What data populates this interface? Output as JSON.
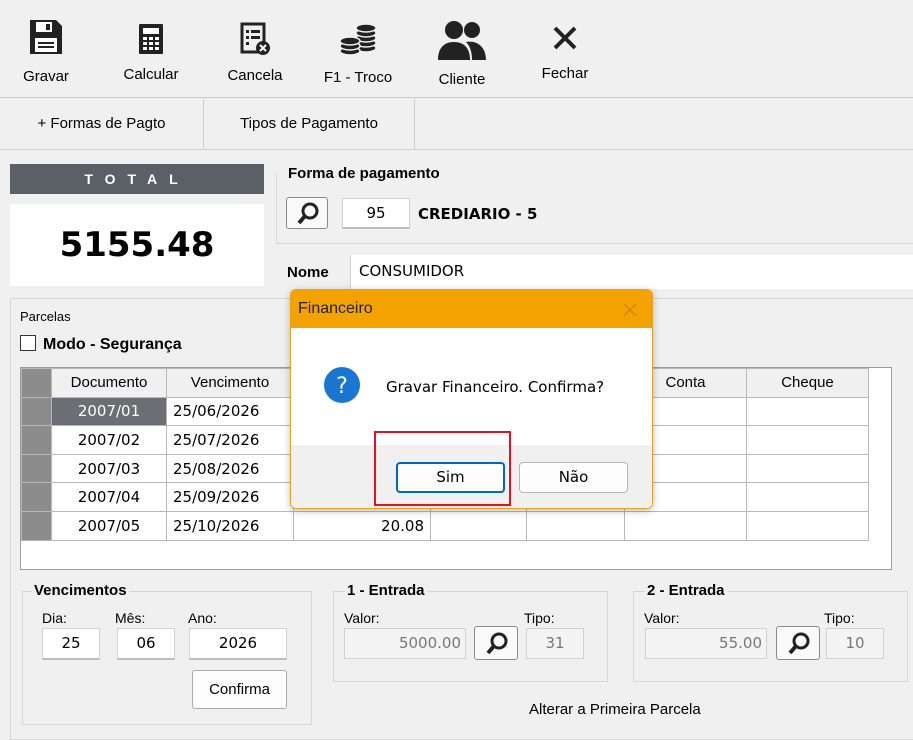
{
  "toolbar": {
    "gravar": "Gravar",
    "calcular": "Calcular",
    "cancela": "Cancela",
    "troco": "F1 - Troco",
    "cliente": "Cliente",
    "fechar": "Fechar"
  },
  "tabs": {
    "formas": "+ Formas de Pagto",
    "tipos": "Tipos de Pagamento"
  },
  "total": {
    "label": "TOTAL",
    "value": "5155.48"
  },
  "forma_pagamento": {
    "label": "Forma de pagamento",
    "code": "95",
    "name": "CREDIARIO - 5"
  },
  "nome": {
    "label": "Nome",
    "value": "CONSUMIDOR"
  },
  "parcelas": {
    "label": "Parcelas",
    "modo_seguranca": "Modo - Segurança"
  },
  "grid": {
    "columns": [
      "Documento",
      "Vencimento",
      "",
      "",
      "",
      "Conta",
      "Cheque"
    ],
    "rows": [
      {
        "documento": "2007/01",
        "vencimento": "25/06/2026",
        "valor": ""
      },
      {
        "documento": "2007/02",
        "vencimento": "25/07/2026",
        "valor": ""
      },
      {
        "documento": "2007/03",
        "vencimento": "25/08/2026",
        "valor": ""
      },
      {
        "documento": "2007/04",
        "vencimento": "25/09/2026",
        "valor": ""
      },
      {
        "documento": "2007/05",
        "vencimento": "25/10/2026",
        "valor": "20.08"
      }
    ]
  },
  "vencimentos": {
    "label": "Vencimentos",
    "dia_label": "Dia:",
    "mes_label": "Mês:",
    "ano_label": "Ano:",
    "dia": "25",
    "mes": "06",
    "ano": "2026",
    "confirma": "Confirma"
  },
  "entrada1": {
    "label": "1 - Entrada",
    "valor_label": "Valor:",
    "tipo_label": "Tipo:",
    "valor": "5000.00",
    "tipo": "31"
  },
  "entrada2": {
    "label": "2 - Entrada",
    "valor_label": "Valor:",
    "tipo_label": "Tipo:",
    "valor": "55.00",
    "tipo": "10"
  },
  "alterar_label": "Alterar a Primeira Parcela",
  "dialog": {
    "title": "Financeiro",
    "message": "Gravar Financeiro. Confirma?",
    "yes": "Sim",
    "no": "Não"
  },
  "colors": {
    "dialog_title": "#f3a200",
    "highlight": "#e0141e",
    "info_icon": "#1976d2"
  }
}
